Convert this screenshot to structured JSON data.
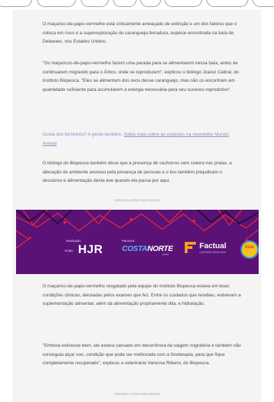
{
  "article": {
    "paragraphs": {
      "p1": "O maçarico-de-papo-vermelho está criticamente ameaçado de extinção e um dos fatores que o coloca em risco é a superexploração do caranguejo-ferradura, espécie encontrada na baía de Delaware, nos Estados Unidos.",
      "p2": "\"Os maçaricos-de-papo-vermelho fazem uma parada para se alimentarem nessa baía, antes de continuarem migrando para o Ártico, onde se reproduzem\", explicou o biólogo Joarez Cabral, do Instituto Biopesca. \"Eles se alimentam dos ovos desse caranguejo, mas não os encontram em quantidade suficiente para acumularem a energia necessária para seu sucesso reprodutivo\".",
      "p3_prefix": "Gosta dos bichinhos? A gente também.",
      "p3_link": "Saiba mais sobre as espécies na newsletter Mundo Animal",
      "p4": "O biólogo do Biopesca também disse que a presença de cachorros sem coleira nas praias, a alteração do ambiente arenoso pela presença de pessoas e o lixo também prejudicam o descanso e alimentação desta ave quando ela passa por aqui.",
      "p5": "O maçarico-de-papo-vermelho resgatado pela equipe do Instituto Biopesca estava em boas condições clínicas, atestadas pelos exames que fez. Entre os cuidados que recebeu, estiveram a suplementação alimentar, além da alimentação propriamente dita, e hidratação.",
      "p6": "\"Embora estivesse bem, ele estava cansado em decorrência da viagem migratória e também não conseguia alçar voo, condição que pode ser melhorada com a fisioterapia, para que fique completamente recuperado\", explicou a veterinária Vanessa Ribeiro, do Biopesca."
    },
    "ad_label_1": "CONTINUA APÓS PUBLICIDADE",
    "ad_label_2": "CONTINUA APÓS PUBLICIDADE"
  },
  "banner": {
    "realizacao_label": "Realização",
    "grupo_label": "Grupo",
    "hjr": "HJR",
    "parceiros_label": "Parceiros",
    "costa": "COSTA",
    "norte": "NORTE",
    "costa_sub": "jornal",
    "factual": "Factual",
    "factual_sub": "CONTEÚDO PRODUZIDO",
    "badge": "Kids",
    "colors": {
      "background": "#5a1277",
      "accent_red": "#e0273d",
      "costa_blue": "#4fb7ff",
      "factual_orange": "#f5a21b"
    }
  },
  "icons": [
    "factual-f-logo-icon",
    "decorative-pattern-icon"
  ]
}
